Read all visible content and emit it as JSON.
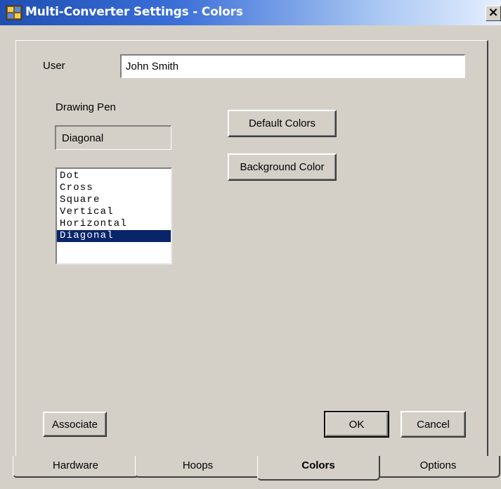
{
  "window": {
    "title": "Multi-Converter Settings - Colors",
    "close_label": "×",
    "app_icon": "app-grid-icon",
    "title_gradient_start": "#1f4fb2",
    "title_gradient_end": "#e6efff"
  },
  "user": {
    "label": "User",
    "value": "John Smith"
  },
  "drawing_pen": {
    "label": "Drawing Pen",
    "current": "Diagonal",
    "options": [
      "Dot",
      "Cross",
      "Square",
      "Vertical",
      "Horizontal",
      "Diagonal"
    ],
    "selected": "Diagonal",
    "selection_color": "#0a246a"
  },
  "buttons": {
    "default_colors": "Default Colors",
    "background_color": "Background Color",
    "associate": "Associate",
    "ok": "OK",
    "cancel": "Cancel"
  },
  "tabs": [
    {
      "label": "Hardware"
    },
    {
      "label": "Hoops"
    },
    {
      "label": "Colors",
      "active": true
    },
    {
      "label": "Options"
    }
  ]
}
